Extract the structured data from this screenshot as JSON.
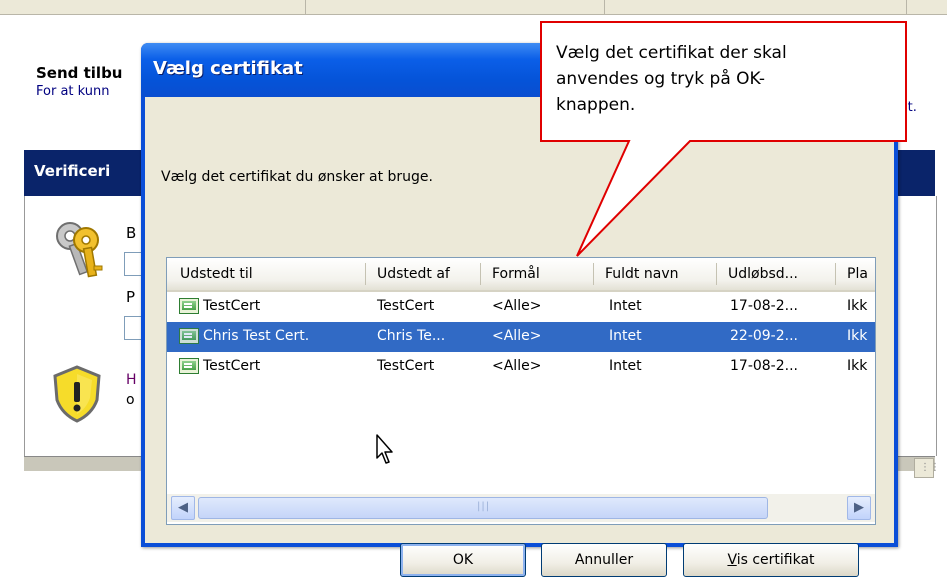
{
  "page": {
    "send_title": "Send tilbu",
    "send_desc": "For at kunn",
    "send_desc_end": "lt.",
    "verification_label": "Verificeri",
    "side_letter_b": "B",
    "side_letter_p": "P",
    "side_letter_h": "H",
    "side_letter_o": "o"
  },
  "dialog": {
    "title": "Vælg certifikat",
    "prompt": "Vælg det certifikat du ønsker at bruge.",
    "columns": [
      "Udstedt til",
      "Udstedt af",
      "Formål",
      "Fuldt navn",
      "Udløbsd...",
      "Pla"
    ],
    "rows": [
      {
        "issued_to": "TestCert",
        "issued_by": "TestCert",
        "purpose": "<Alle>",
        "full_name": "Intet",
        "expires": "17-08-2...",
        "place": "Ikk",
        "selected": false
      },
      {
        "issued_to": "Chris Test Cert.",
        "issued_by": "Chris Te...",
        "purpose": "<Alle>",
        "full_name": "Intet",
        "expires": "22-09-2...",
        "place": "Ikk",
        "selected": true
      },
      {
        "issued_to": "TestCert",
        "issued_by": "TestCert",
        "purpose": "<Alle>",
        "full_name": "Intet",
        "expires": "17-08-2...",
        "place": "Ikk",
        "selected": false
      }
    ],
    "buttons": {
      "ok": "OK",
      "cancel": "Annuller",
      "view_prefix": "V",
      "view_rest": "is certifikat"
    }
  },
  "callout": {
    "line1": "Vælg det certifikat der skal",
    "line2": "anvendes og tryk på OK-",
    "line3": "knappen."
  },
  "icons": {
    "keys": "keys-icon",
    "shield": "warning-shield-icon",
    "certificate": "certificate-icon",
    "cursor": "mouse-cursor-icon"
  },
  "colors": {
    "selection": "#316ac5",
    "titlebar": "#0553d8",
    "callout_border": "#e00000"
  }
}
